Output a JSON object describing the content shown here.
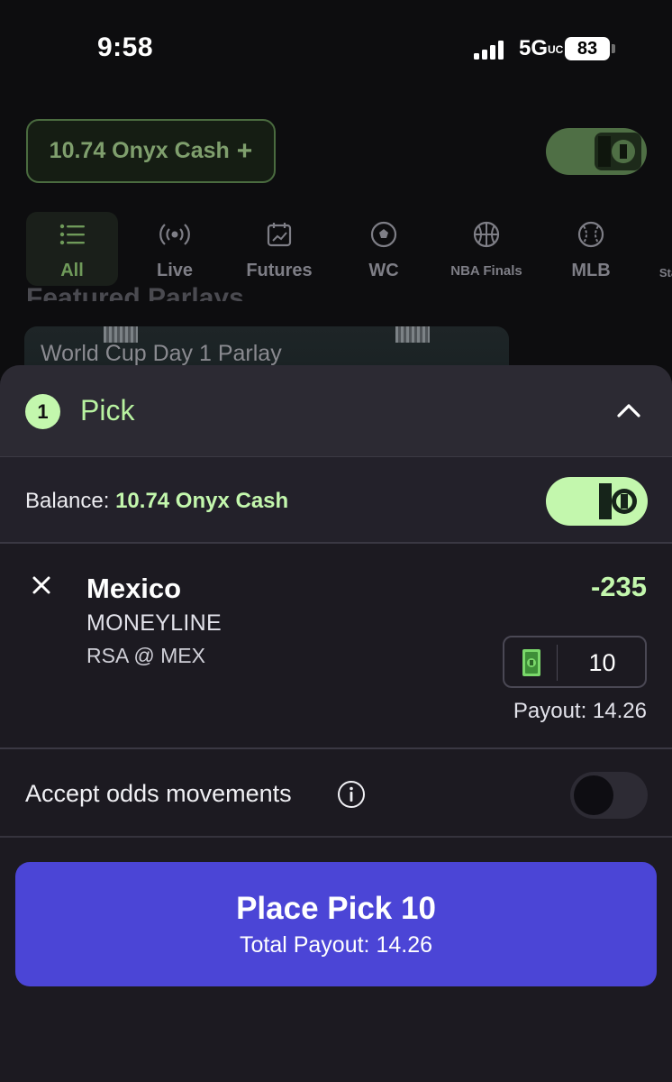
{
  "status_bar": {
    "time": "9:58",
    "network": "5G",
    "network_suffix": "UC",
    "battery": "83"
  },
  "background": {
    "cash_button_label": "10.74 Onyx Cash",
    "cash_button_plus": "+",
    "tabs": [
      {
        "label": "All",
        "icon": "list-icon"
      },
      {
        "label": "Live",
        "icon": "broadcast-icon"
      },
      {
        "label": "Futures",
        "icon": "calendar-chart-icon"
      },
      {
        "label": "WC",
        "icon": "soccer-ball-icon"
      },
      {
        "label": "NBA Finals",
        "icon": "basketball-icon"
      },
      {
        "label": "MLB",
        "icon": "baseball-icon"
      },
      {
        "label": "Sta",
        "icon": ""
      }
    ],
    "featured_title": "Featured Parlays",
    "featured_card_title": "World Cup Day 1 Parlay"
  },
  "bet_slip": {
    "pick_count": "1",
    "title": "Pick",
    "balance_label": "Balance:",
    "balance_value": "10.74 Onyx Cash",
    "pick": {
      "team": "Mexico",
      "market": "MONEYLINE",
      "event": "RSA @ MEX",
      "odds": "-235",
      "stake": "10",
      "payout": "Payout: 14.26"
    },
    "accept_odds_label": "Accept odds movements",
    "accept_odds_enabled": false,
    "cash_mode_enabled": true,
    "place_button_label": "Place Pick 10",
    "total_payout": "Total Payout: 14.26"
  },
  "colors": {
    "accent_green": "#c3f7ad",
    "button_purple": "#4b45d6",
    "sheet_bg": "#1c1a21"
  }
}
